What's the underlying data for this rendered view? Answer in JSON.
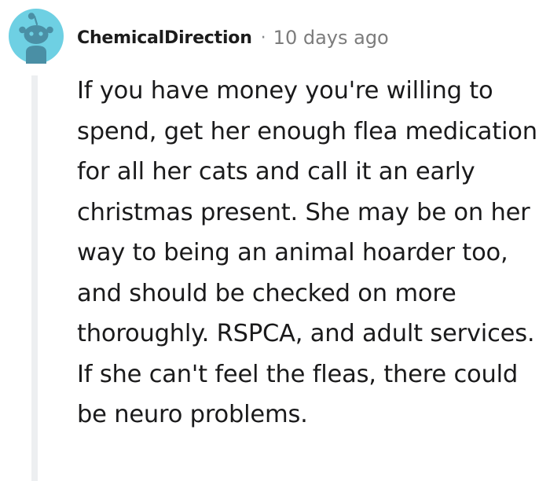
{
  "comment": {
    "username": "ChemicalDirection",
    "separator": "·",
    "timestamp": "10 days ago",
    "body": "If you have money you're willing to spend, get her enough flea medication for all her cats and call it an early christmas present. She may be on her way to being an animal hoarder too, and should be checked on more thoroughly. RSPCA, and adult services. If she can't feel the fleas, there could be neuro problems.",
    "avatar_icon": "snoo-avatar-icon"
  },
  "colors": {
    "avatar_background": "#6ed0e3",
    "avatar_figure": "#4a8fa5",
    "thread_line": "#edeff1",
    "username": "#1c1c1c",
    "timestamp": "#7c7c7c",
    "body_text": "#1a1a1b"
  }
}
